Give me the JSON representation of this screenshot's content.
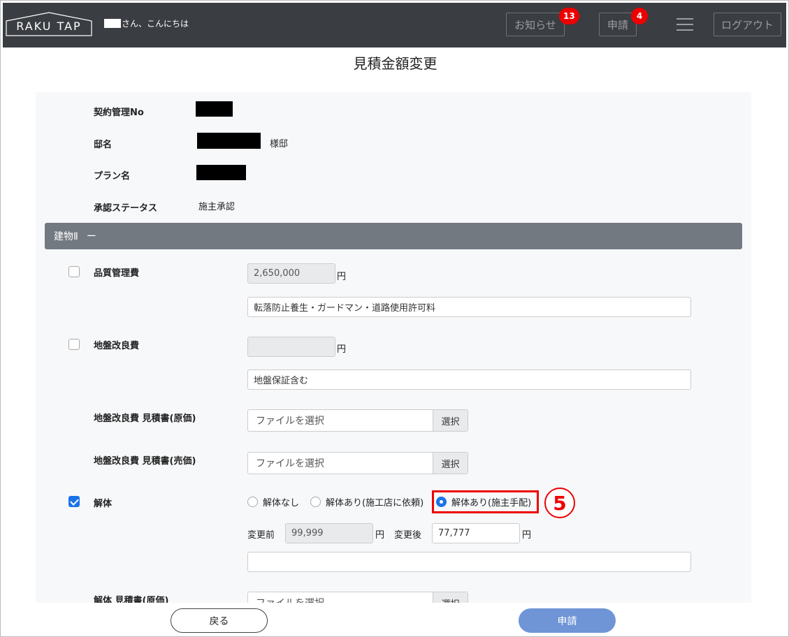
{
  "header": {
    "logo_text": "RAKU TAP",
    "greeting_suffix": "さん、こんにちは",
    "notice_label": "お知らせ",
    "notice_count": "13",
    "apply_label": "申請",
    "apply_count": "4",
    "logout_label": "ログアウト"
  },
  "page_title": "見積金額変更",
  "info": {
    "contract_no_label": "契約管理No",
    "residence_label": "邸名",
    "residence_suffix": "様邸",
    "plan_label": "プラン名",
    "status_label": "承認ステータス",
    "status_value": "施主承認"
  },
  "section": {
    "title": "建物Ⅱ",
    "collapse_symbol": "ー"
  },
  "items": {
    "quality": {
      "label": "品質管理費",
      "amount": "2,650,000",
      "unit": "円",
      "note": "転落防止養生・ガードマン・道路使用許可料"
    },
    "ground": {
      "label": "地盤改良費",
      "amount": "",
      "unit": "円",
      "note": "地盤保証含む"
    },
    "ground_cost_file": {
      "label": "地盤改良費 見積書(原価)",
      "placeholder": "ファイルを選択",
      "button": "選択"
    },
    "ground_sale_file": {
      "label": "地盤改良費 見積書(売価)",
      "placeholder": "ファイルを選択",
      "button": "選択"
    },
    "demolition": {
      "label": "解体",
      "radio_none": "解体なし",
      "radio_builder": "解体あり(施工店に依頼)",
      "radio_owner": "解体あり(施主手配)",
      "before_label": "変更前",
      "before_value": "99,999",
      "after_label": "変更後",
      "after_value": "77,777",
      "unit": "円",
      "note": ""
    },
    "demolition_cost_file": {
      "label": "解体 見積書(原価)",
      "placeholder": "ファイルを選択",
      "button": "選択"
    }
  },
  "annotation": {
    "step_number": "5"
  },
  "footer": {
    "back_label": "戻る",
    "submit_label": "申請"
  }
}
